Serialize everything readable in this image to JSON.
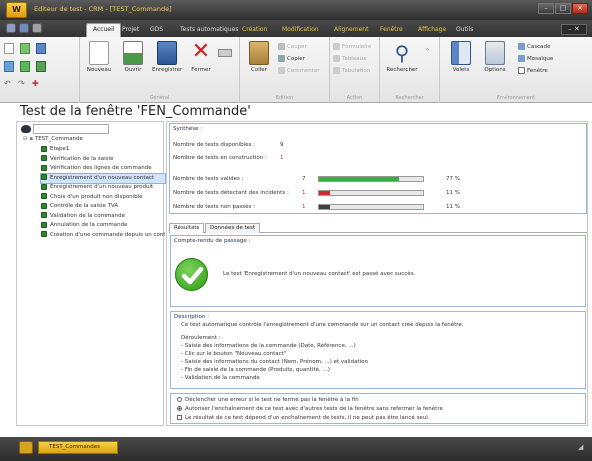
{
  "window": {
    "logo": "W",
    "title": "Editeur de test - CRM - [TEST_Commande]",
    "minimize": "–",
    "maximize": "□",
    "close": "×"
  },
  "menu": {
    "tabs": [
      {
        "label": "Accueil",
        "active": true,
        "highlight": false
      },
      {
        "label": "Projet",
        "active": false,
        "highlight": false
      },
      {
        "label": "GDS",
        "active": false,
        "highlight": false
      },
      {
        "label": "Tests automatiques",
        "active": false,
        "highlight": false
      },
      {
        "label": "Création",
        "active": false,
        "highlight": true
      },
      {
        "label": "Modification",
        "active": false,
        "highlight": true
      },
      {
        "label": "Alignement",
        "active": false,
        "highlight": true
      },
      {
        "label": "Fenêtre",
        "active": false,
        "highlight": true
      },
      {
        "label": "Affichage",
        "active": false,
        "highlight": true
      },
      {
        "label": "Outils",
        "active": false,
        "highlight": false
      }
    ],
    "right_controls": "– ✕"
  },
  "ribbon": {
    "general": {
      "label": "Général",
      "buttons": [
        "Nouveau",
        "Ouvrir",
        "Enregistrer",
        "Fermer"
      ]
    },
    "edition": {
      "label": "Edition",
      "paste": "Coller",
      "cut": "Couper",
      "copy": "Copier",
      "comment": "Commenter"
    },
    "actions": {
      "label": "Action",
      "items": [
        "Formulaire",
        "Tableaux",
        "Tabulation"
      ]
    },
    "search": {
      "label": "Rechercher",
      "button": "Rechercher"
    },
    "environment": {
      "label": "Environnement",
      "volets": "Volets",
      "options": "Options",
      "cascade": "Cascade",
      "mosaique": "Mosaïque",
      "fenetre": "Fenêtre"
    }
  },
  "page": {
    "title": "Test de la fenêtre 'FEN_Commande'"
  },
  "tree": {
    "root": "TEST_Commande",
    "items": [
      {
        "label": "Etape1",
        "selected": false
      },
      {
        "label": "Vérification de la saisie",
        "selected": false
      },
      {
        "label": "Vérification des lignes de commande",
        "selected": false
      },
      {
        "label": "Enregistrement d'un nouveau contact",
        "selected": true
      },
      {
        "label": "Enregistrement d'un nouveau produit",
        "selected": false
      },
      {
        "label": "Choix d'un produit non disponible",
        "selected": false
      },
      {
        "label": "Contrôle de la saisie TVA",
        "selected": false
      },
      {
        "label": "Validation de la commande",
        "selected": false
      },
      {
        "label": "Annulation de la commande",
        "selected": false
      },
      {
        "label": "Création d'une commande depuis un contact",
        "selected": false
      }
    ]
  },
  "synthesis": {
    "title": "Synthèse :",
    "available_label": "Nombre de tests disponibles :",
    "available_value": "9",
    "construction_label": "Nombre de tests en construction :",
    "construction_value": "1",
    "rows": [
      {
        "label": "Nombre de tests valides :",
        "value": "7",
        "percent": "77 %",
        "fraction": 0.77,
        "color": "#39b039"
      },
      {
        "label": "Nombre de tests détectant des incidents :",
        "value": "1",
        "percent": "11 %",
        "fraction": 0.11,
        "color": "#c83030"
      },
      {
        "label": "Nombre de tests non passés :",
        "value": "1",
        "percent": "11 %",
        "fraction": 0.11,
        "color": "#404040"
      }
    ]
  },
  "tabs": [
    "Résultats",
    "Données de test"
  ],
  "report": {
    "title": "Compte-rendu de passage :",
    "message": "Le test 'Enregistrement d'un nouveau contact' est passé avec succès."
  },
  "description": {
    "title": "Description :",
    "intro": "Ce test automatique contrôle l'enregistrement d'une commande sur un contact créé depuis la fenêtre.",
    "steps_title": "Déroulement :",
    "steps": [
      "- Saisie des informations de la commande (Date, Référence, ...)",
      "- Clic sur le bouton \"Nouveau contact\"",
      "- Saisie des informations du contact (Nom, Prénom, ...) et validation",
      "- Fin de saisie de la commande (Produits, quantité, ...)",
      "- Validation de la commande"
    ]
  },
  "options": {
    "radio1": "Déclencher une erreur si le test ne ferme pas la fenêtre à la fin",
    "radio2": "Autoriser l'enchaînement de ce test avec d'autres tests de la fenêtre sans refermer la fenêtre",
    "checkbox": "Le résultat de ce test dépend d'un enchaînement de tests, il ne peut pas être lancé seul."
  },
  "statusbar": {
    "tab_label": "TEST_Commandes",
    "corner": "◢"
  }
}
